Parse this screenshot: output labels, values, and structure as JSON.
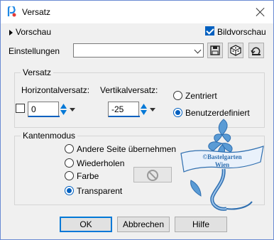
{
  "window": {
    "title": "Versatz"
  },
  "preview": {
    "label": "Vorschau",
    "bildvorschau_label": "Bildvorschau",
    "bildvorschau_checked": true
  },
  "settings": {
    "label": "Einstellungen",
    "value": ""
  },
  "offset_group": {
    "title": "Versatz",
    "horizontal_label": "Horizontalversatz:",
    "horizontal_value": "0",
    "vertical_label": "Vertikalversatz:",
    "vertical_value": "-25",
    "centered_label": "Zentriert",
    "custom_label": "Benutzerdefiniert",
    "selected": "Benutzerdefiniert"
  },
  "edge_group": {
    "title": "Kantenmodus",
    "options": [
      "Andere Seite übernehmen",
      "Wiederholen",
      "Farbe",
      "Transparent"
    ],
    "selected": "Transparent"
  },
  "watermark": {
    "line1": "©Bastelgarten",
    "line2": "Wien"
  },
  "buttons": {
    "ok": "OK",
    "cancel": "Abbrechen",
    "help": "Hilfe"
  },
  "colors": {
    "accent": "#0060c0",
    "dialog_bg": "#f0f0f0",
    "watermark": "#3a7fc0"
  },
  "icons": [
    "app-icon",
    "close-icon",
    "save-preset-icon",
    "randomize-icon",
    "reset-icon",
    "no-color-icon"
  ]
}
